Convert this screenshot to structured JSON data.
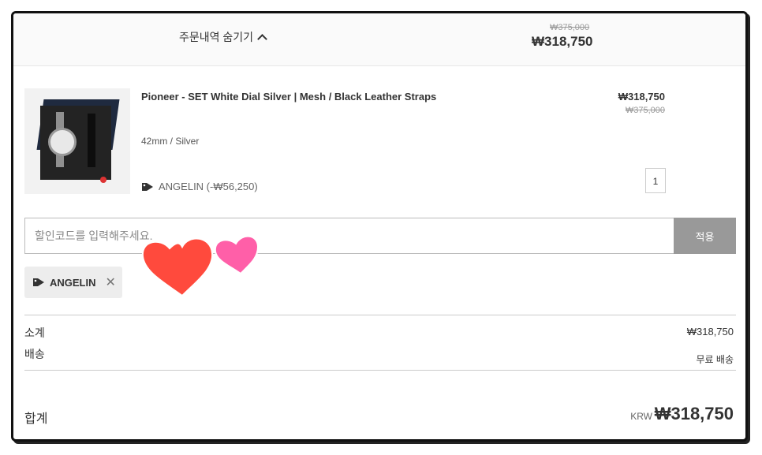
{
  "header": {
    "toggle_label": "주문내역 숨기기",
    "original_total": "₩375,000",
    "total": "₩318,750"
  },
  "item": {
    "name": "Pioneer - SET White Dial Silver | Mesh / Black Leather Straps",
    "variant": "42mm / Silver",
    "discount_label": "ANGELIN (-₩56,250)",
    "price": "₩318,750",
    "original_price": "₩375,000",
    "quantity": "1"
  },
  "discount_code": {
    "placeholder": "할인코드를 입력해주세요.",
    "apply_label": "적용",
    "applied_code": "ANGELIN"
  },
  "summary": {
    "subtotal_label": "소계",
    "subtotal_value": "₩318,750",
    "shipping_label": "배송",
    "shipping_value": "무료 배송",
    "total_label": "합계",
    "currency": "KRW",
    "total_value": "₩318,750"
  },
  "icons": {
    "toggle": "chevron-up-icon",
    "tag": "tag-icon",
    "remove": "close-icon",
    "decoration": "heart-stickers"
  },
  "colors": {
    "apply_button": "#999999",
    "heart_red": "#ff4a3d",
    "heart_pink": "#ff5fa8"
  }
}
